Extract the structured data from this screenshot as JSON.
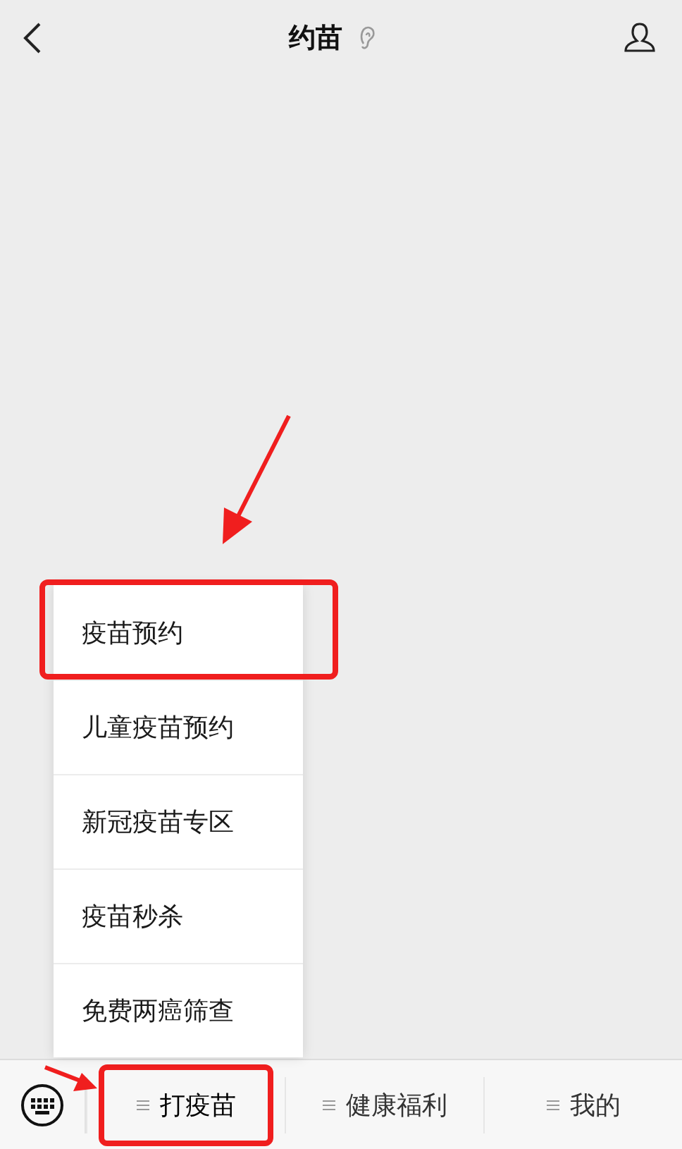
{
  "header": {
    "title": "约苗"
  },
  "menu": {
    "items": [
      {
        "label": "疫苗预约",
        "highlighted": true
      },
      {
        "label": "儿童疫苗预约",
        "highlighted": false
      },
      {
        "label": "新冠疫苗专区",
        "highlighted": false
      },
      {
        "label": "疫苗秒杀",
        "highlighted": false
      },
      {
        "label": "免费两癌筛查",
        "highlighted": false
      }
    ]
  },
  "bottom_bar": {
    "tabs": [
      {
        "label": "打疫苗",
        "highlighted": true
      },
      {
        "label": "健康福利",
        "highlighted": false
      },
      {
        "label": "我的",
        "highlighted": false
      }
    ]
  }
}
